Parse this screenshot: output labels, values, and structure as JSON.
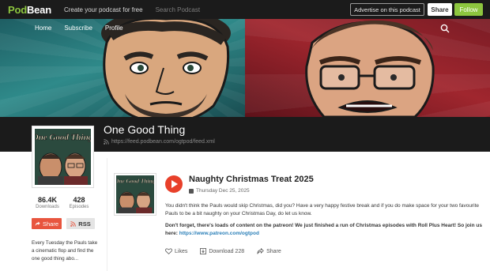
{
  "topbar": {
    "logo_part1": "Pod",
    "logo_part2": "Bean",
    "create_link": "Create your podcast for free",
    "search_placeholder": "Search Podcast",
    "advertise_label": "Advertise on this podcast",
    "share_label": "Share",
    "follow_label": "Follow"
  },
  "nav": {
    "items": [
      "Home",
      "Subscribe",
      "Profile"
    ]
  },
  "podcast": {
    "title": "One Good Thing",
    "feed_url": "https://feed.podbean.com/ogtpod/feed.xml",
    "cover_text": "One Good Thing",
    "downloads_count": "86.4K",
    "downloads_label": "Downloads",
    "episodes_count": "428",
    "episodes_label": "Episodes",
    "share_label": "Share",
    "rss_label": "RSS",
    "description": "Every Tuesday the Pauls take a cinematic flop and find the one good thing abo..."
  },
  "episode": {
    "title": "Naughty Christmas Treat 2025",
    "date": "Thursday Dec 25, 2025",
    "paragraph1": "You didn't think the Pauls would skip Christmas, did you? Have a very happy festive break and if you do make space for your two favourite Pauls to be a bit naughty on your Christmas Day, do let us know.",
    "paragraph2_bold": "Don't forget, there's loads of content on the patreon! We just finished a run of Christmas episodes with Roll Plus Heart! So join us here:",
    "link": "https://www.patreon.com/ogtpod",
    "likes_label": "Likes",
    "download_label": "Download 228",
    "share_label": "Share"
  },
  "colors": {
    "brand_green": "#8dc63f",
    "play_red": "#e8402a",
    "share_orange": "#e8553e",
    "banner_teal": "#2f8a8a",
    "banner_red": "#a0262e",
    "link_blue": "#2a7fb8"
  },
  "icons": [
    "search-icon",
    "rss-icon",
    "calendar-icon",
    "play-icon",
    "heart-icon",
    "download-icon",
    "share-icon"
  ]
}
